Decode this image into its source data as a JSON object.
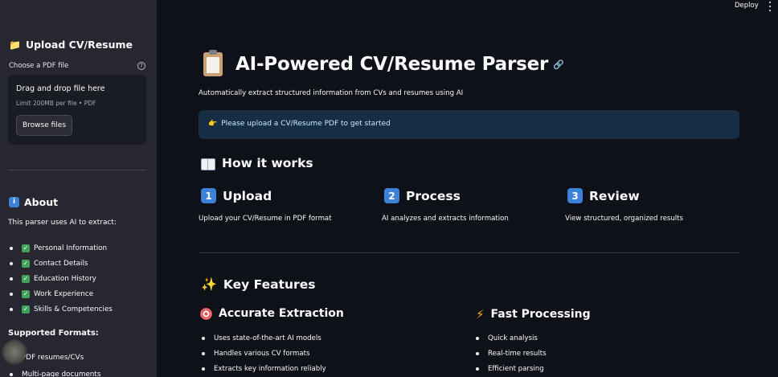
{
  "topbar": {
    "deploy_label": "Deploy",
    "menu_icon": "more-vertical-icon"
  },
  "sidebar": {
    "upload_heading": "Upload CV/Resume",
    "upload_heading_icon": "folder-icon",
    "file_label": "Choose a PDF file",
    "help_glyph": "?",
    "dropzone_title": "Drag and drop file here",
    "dropzone_limit": "Limit 200MB per file • PDF",
    "browse_label": "Browse files",
    "about_heading": "About",
    "about_heading_icon": "info-icon",
    "about_intro": "This parser uses AI to extract:",
    "about_items": [
      "Personal Information",
      "Contact Details",
      "Education History",
      "Work Experience",
      "Skills & Competencies"
    ],
    "formats_heading": "Supported Formats:",
    "formats_items": [
      "PDF resumes/CVs",
      "Multi-page documents"
    ]
  },
  "main": {
    "title": "AI-Powered CV/Resume Parser",
    "subtitle": "Automatically extract structured information from CVs and resumes using AI",
    "info_message": "Please upload a CV/Resume PDF to get started",
    "how_heading": "How it works",
    "steps": [
      {
        "num": "1",
        "title": "Upload",
        "desc": "Upload your CV/Resume in PDF format"
      },
      {
        "num": "2",
        "title": "Process",
        "desc": "AI analyzes and extracts information"
      },
      {
        "num": "3",
        "title": "Review",
        "desc": "View structured, organized results"
      }
    ],
    "features_heading": "Key Features",
    "features": [
      {
        "title": "Accurate Extraction",
        "icon": "target-icon",
        "items": [
          "Uses state-of-the-art AI models",
          "Handles various CV formats",
          "Extracts key information reliably"
        ]
      },
      {
        "title": "Fast Processing",
        "icon": "lightning-icon",
        "items": [
          "Quick analysis",
          "Real-time results",
          "Efficient parsing"
        ]
      }
    ]
  },
  "colors": {
    "background": "#0e1117",
    "sidebar": "#262730",
    "info_box": "#172d43",
    "info_text": "#c7ebff",
    "keycap": "#3b82d8",
    "check": "#3fa45a"
  }
}
